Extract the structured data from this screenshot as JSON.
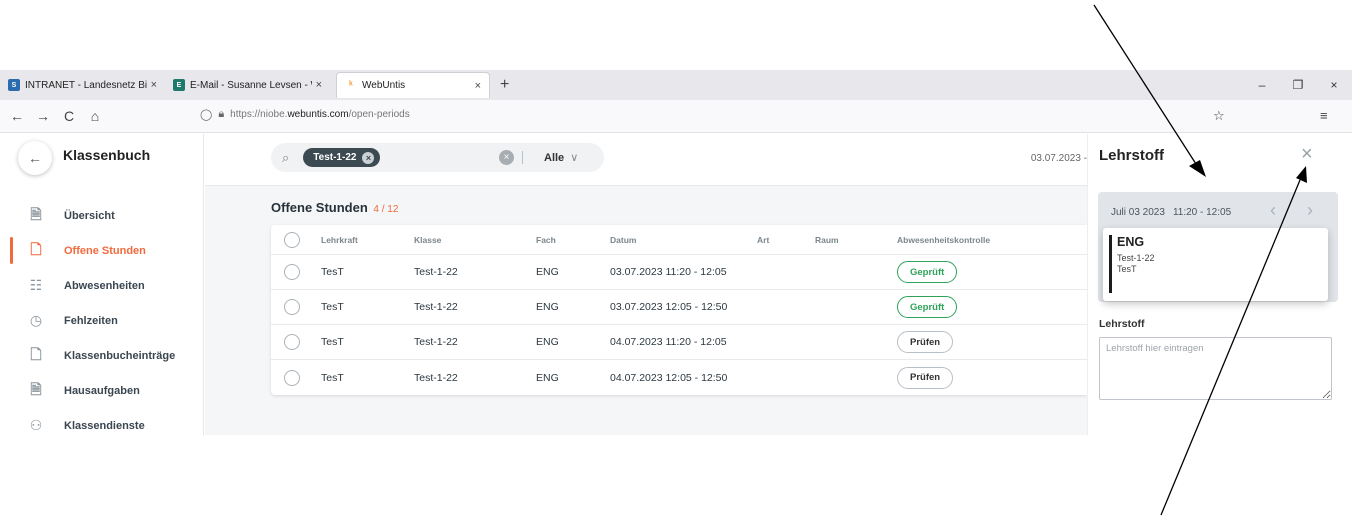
{
  "browser": {
    "tabs": [
      {
        "label": "INTRANET - Landesnetz Bildung",
        "close": "×",
        "fav_color": "#2b6cb0",
        "fav": "S"
      },
      {
        "label": "E-Mail - Susanne Levsen - Web",
        "close": "×",
        "fav_color": "#1e7a6b",
        "fav": "E"
      },
      {
        "label": "WebUntis",
        "close": "×",
        "fav_color": "#f2a23c",
        "fav": "ᵏ"
      }
    ],
    "new_tab": "+",
    "window_controls": [
      "–",
      "❐",
      "×"
    ],
    "nav": {
      "back": "←",
      "forward": "→",
      "reload": "C",
      "home": "⌂"
    },
    "url_prefix": "https://niobe.",
    "url_host": "webuntis.com",
    "url_path": "/open-periods",
    "bookmark_icon": "☆",
    "menu_icon": "≡"
  },
  "sidebar": {
    "back_icon": "←",
    "title": "Klassenbuch",
    "items": [
      {
        "label": "Übersicht",
        "icon": "doc-search-icon",
        "glyph": "🗎"
      },
      {
        "label": "Offene Stunden",
        "icon": "doc-open-icon",
        "glyph": "🗋"
      },
      {
        "label": "Abwesenheiten",
        "icon": "desk-icon",
        "glyph": "☷"
      },
      {
        "label": "Fehlzeiten",
        "icon": "clock-icon",
        "glyph": "◷"
      },
      {
        "label": "Klassenbucheinträge",
        "icon": "doc-add-icon",
        "glyph": "🗋"
      },
      {
        "label": "Hausaufgaben",
        "icon": "homework-icon",
        "glyph": "🗎"
      },
      {
        "label": "Klassendienste",
        "icon": "user-duty-icon",
        "glyph": "⚇"
      }
    ],
    "active_index": 1
  },
  "topbar": {
    "search_icon": "⌕",
    "chip": "Test-1-22",
    "chip_remove": "×",
    "clear_all": "×",
    "filter": "Alle",
    "filter_chev": "∨",
    "date_range": "03.07.2023 -"
  },
  "section": {
    "title": "Offene Stunden",
    "count": "4 / 12"
  },
  "table": {
    "headers": [
      "Lehrkraft",
      "Klasse",
      "Fach",
      "Datum",
      "Art",
      "Raum",
      "Abwesenheitskontrolle"
    ],
    "rows": [
      {
        "lehrkraft": "TesT",
        "klasse": "Test-1-22",
        "fach": "ENG",
        "datum": "03.07.2023 11:20 - 12:05",
        "status": "Geprüft",
        "ok": true
      },
      {
        "lehrkraft": "TesT",
        "klasse": "Test-1-22",
        "fach": "ENG",
        "datum": "03.07.2023 12:05 - 12:50",
        "status": "Geprüft",
        "ok": true
      },
      {
        "lehrkraft": "TesT",
        "klasse": "Test-1-22",
        "fach": "ENG",
        "datum": "04.07.2023 11:20 - 12:05",
        "status": "Prüfen",
        "ok": false
      },
      {
        "lehrkraft": "TesT",
        "klasse": "Test-1-22",
        "fach": "ENG",
        "datum": "04.07.2023 12:05 - 12:50",
        "status": "Prüfen",
        "ok": false
      }
    ]
  },
  "panel": {
    "title": "Lehrstoff",
    "close": "×",
    "period_date": "Juli 03 2023",
    "period_time": "11:20 - 12:05",
    "prev": "‹",
    "next": "›",
    "lesson": {
      "subject": "ENG",
      "class": "Test-1-22",
      "teacher": "TesT"
    },
    "field_label": "Lehrstoff",
    "field_placeholder": "Lehrstoff hier eintragen"
  },
  "colors": {
    "accent": "#f06a3d",
    "ok": "#2fa25a",
    "chip": "#3c4a52"
  }
}
